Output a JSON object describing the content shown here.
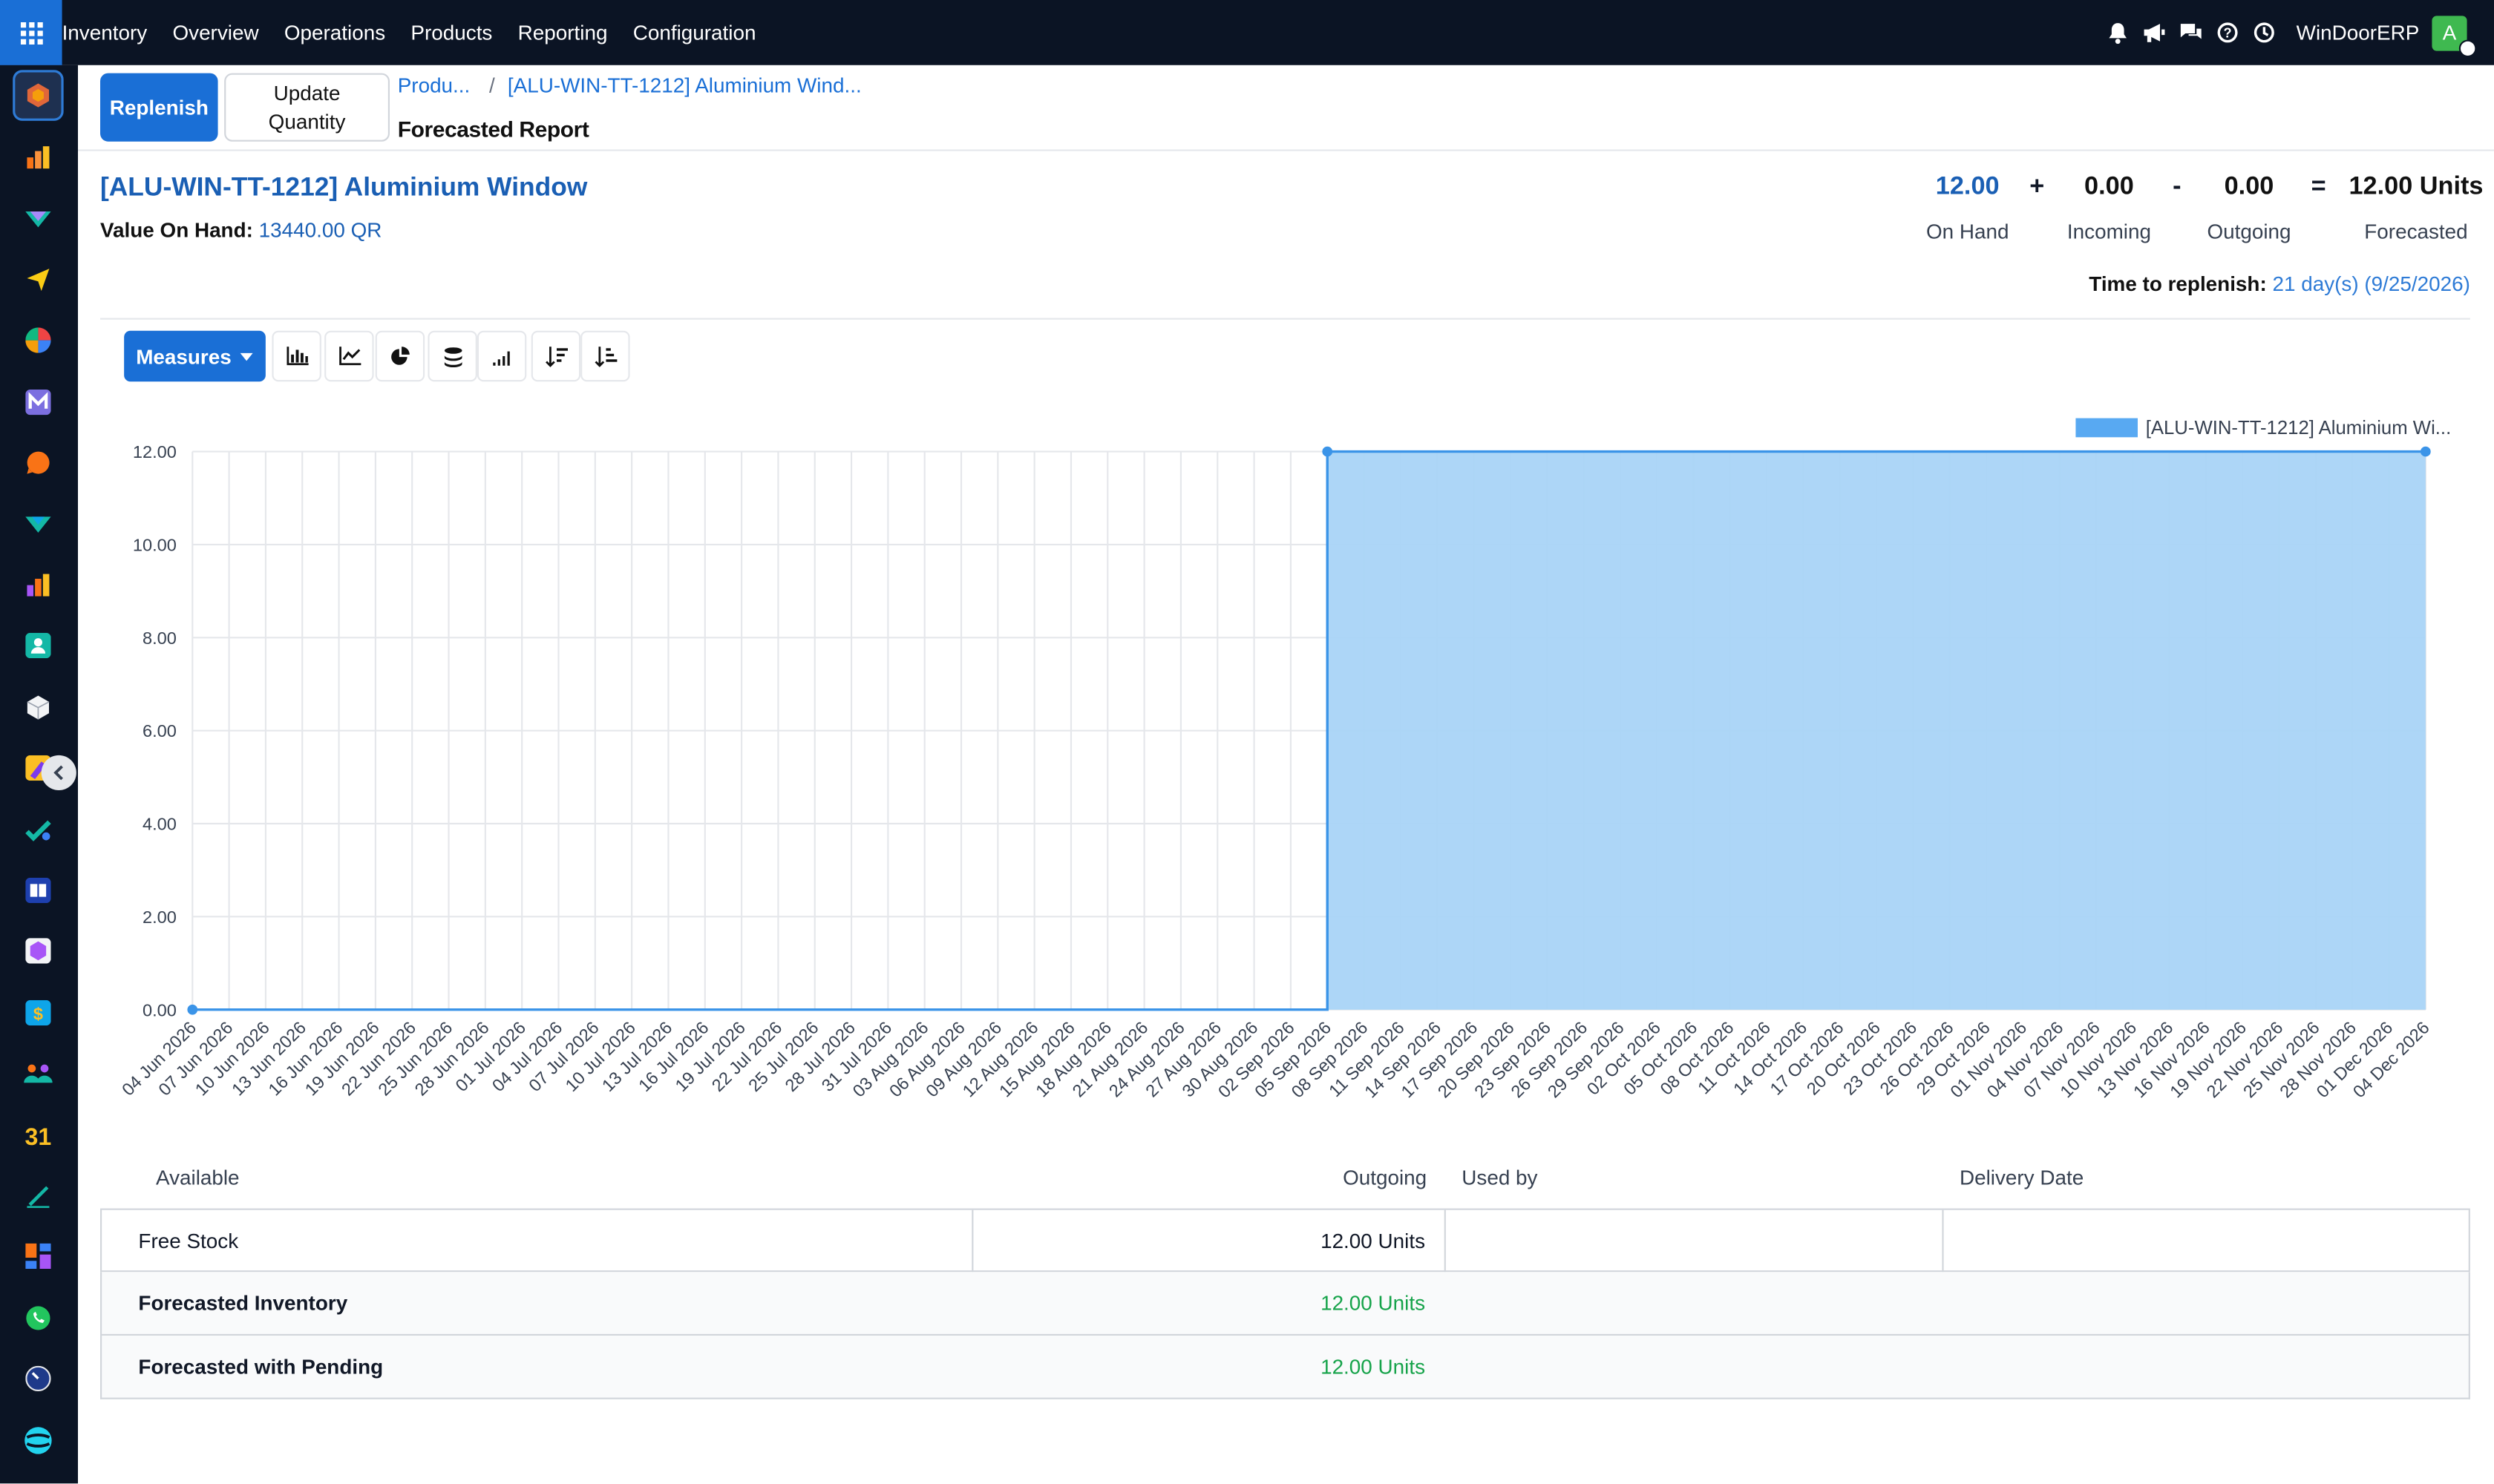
{
  "navbar": {
    "menu": [
      "Inventory",
      "Overview",
      "Operations",
      "Products",
      "Reporting",
      "Configuration"
    ],
    "company": "WinDoorERP",
    "avatar_initial": "A",
    "icons": [
      "bell-icon",
      "megaphone-icon",
      "chat-icon",
      "help-icon",
      "clock-icon"
    ]
  },
  "sidebar": {
    "apps": [
      "inventory-app-icon",
      "sales-app-icon",
      "purchase-app-icon",
      "send-app-icon",
      "pos-app-icon",
      "mail-app-icon",
      "discuss-app-icon",
      "manufacturing-app-icon",
      "reporting-app-icon",
      "contacts-app-icon",
      "product-app-icon",
      "field-app-icon",
      "planning-app-icon",
      "knowledge-app-icon",
      "package-app-icon",
      "accounting-app-icon",
      "employees-app-icon",
      "calendar-app-icon",
      "sign-app-icon",
      "dashboards-app-icon",
      "whatsapp-app-icon",
      "timer-app-icon",
      "website-app-icon"
    ]
  },
  "control_panel": {
    "replenish_label": "Replenish",
    "update_qty_label": "Update\nQuantity",
    "breadcrumb_1": "Produ...",
    "breadcrumb_sep": "/",
    "breadcrumb_2": "[ALU-WIN-TT-1212] Aluminium Wind...",
    "page_title": "Forecasted Report"
  },
  "summary": {
    "product_title": "[ALU-WIN-TT-1212] Aluminium Window",
    "value_label": "Value On Hand:",
    "value": "13440.00 QR",
    "on_hand": "12.00",
    "on_hand_label": "On Hand",
    "plus": "+",
    "incoming": "0.00",
    "incoming_label": "Incoming",
    "minus": "-",
    "outgoing": "0.00",
    "outgoing_label": "Outgoing",
    "equals": "=",
    "forecasted": "12.00 Units",
    "forecasted_label": "Forecasted",
    "replenish_label": "Time to replenish:",
    "replenish_value": "21 day(s) (9/25/2026)"
  },
  "graph_toolbar": {
    "measures_label": "Measures",
    "buttons": [
      "bar-chart-icon",
      "line-chart-icon",
      "pie-chart-icon",
      "stacked-icon",
      "cumulative-icon",
      "sort-descending-icon",
      "sort-ascending-icon"
    ]
  },
  "colors": {
    "primary": "#1a6fd6",
    "area_fill": "#a9d4f7",
    "area_line": "#3b94e8",
    "green": "#16a34a"
  },
  "chart_data": {
    "type": "area",
    "legend": "[ALU-WIN-TT-1212] Aluminium Wi...",
    "legend_position": "top-right",
    "grid": true,
    "ylim": [
      0,
      12
    ],
    "yticks": [
      "0.00",
      "2.00",
      "4.00",
      "6.00",
      "8.00",
      "10.00",
      "12.00"
    ],
    "x": [
      "04 Jun 2026",
      "07 Jun 2026",
      "10 Jun 2026",
      "13 Jun 2026",
      "16 Jun 2026",
      "19 Jun 2026",
      "22 Jun 2026",
      "25 Jun 2026",
      "28 Jun 2026",
      "01 Jul 2026",
      "04 Jul 2026",
      "07 Jul 2026",
      "10 Jul 2026",
      "13 Jul 2026",
      "16 Jul 2026",
      "19 Jul 2026",
      "22 Jul 2026",
      "25 Jul 2026",
      "28 Jul 2026",
      "31 Jul 2026",
      "03 Aug 2026",
      "06 Aug 2026",
      "09 Aug 2026",
      "12 Aug 2026",
      "15 Aug 2026",
      "18 Aug 2026",
      "21 Aug 2026",
      "24 Aug 2026",
      "27 Aug 2026",
      "30 Aug 2026",
      "02 Sep 2026",
      "05 Sep 2026",
      "08 Sep 2026",
      "11 Sep 2026",
      "14 Sep 2026",
      "17 Sep 2026",
      "20 Sep 2026",
      "23 Sep 2026",
      "26 Sep 2026",
      "29 Sep 2026",
      "02 Oct 2026",
      "05 Oct 2026",
      "08 Oct 2026",
      "11 Oct 2026",
      "14 Oct 2026",
      "17 Oct 2026",
      "20 Oct 2026",
      "23 Oct 2026",
      "26 Oct 2026",
      "29 Oct 2026",
      "01 Nov 2026",
      "04 Nov 2026",
      "07 Nov 2026",
      "10 Nov 2026",
      "13 Nov 2026",
      "16 Nov 2026",
      "19 Nov 2026",
      "22 Nov 2026",
      "25 Nov 2026",
      "28 Nov 2026",
      "01 Dec 2026",
      "04 Dec 2026"
    ],
    "series": [
      {
        "name": "[ALU-WIN-TT-1212] Aluminium Window",
        "points": [
          [
            "04 Jun 2026",
            0
          ],
          [
            "05 Sep 2026",
            0
          ],
          [
            "05 Sep 2026",
            12
          ],
          [
            "04 Dec 2026",
            12
          ]
        ],
        "markers": [
          [
            "04 Jun 2026",
            0
          ],
          [
            "05 Sep 2026",
            12
          ],
          [
            "04 Dec 2026",
            12
          ]
        ]
      }
    ]
  },
  "table": {
    "headers": {
      "available": "Available",
      "outgoing": "Outgoing",
      "used_by": "Used by",
      "delivery_date": "Delivery Date"
    },
    "free_stock_label": "Free Stock",
    "free_stock_value": "12.00 Units",
    "forecasted_inventory_label": "Forecasted Inventory",
    "forecasted_inventory_value": "12.00 Units",
    "forecasted_pending_label": "Forecasted with Pending",
    "forecasted_pending_value": "12.00 Units"
  }
}
